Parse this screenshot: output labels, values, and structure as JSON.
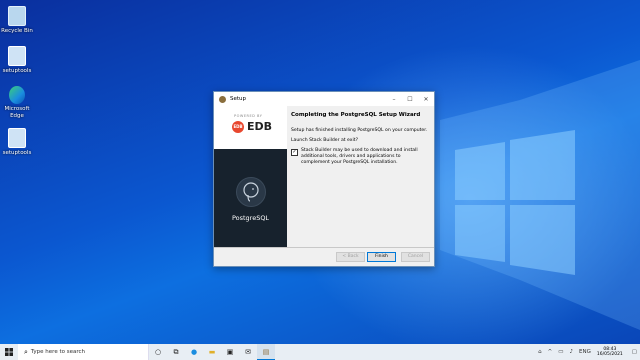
{
  "desktop": {
    "icons": [
      {
        "name": "recycle-bin",
        "label": "Recycle Bin"
      },
      {
        "name": "setuptools-1",
        "label": "setuptools"
      },
      {
        "name": "microsoft-edge",
        "label": "Microsoft Edge"
      },
      {
        "name": "setuptools-2",
        "label": "setuptools"
      }
    ]
  },
  "window": {
    "title": "Setup",
    "brand": {
      "powered": "POWERED BY",
      "badge": "EDB",
      "edb": "EDB"
    },
    "product": "PostgreSQL",
    "heading": "Completing the PostgreSQL Setup Wizard",
    "finished_text": "Setup has finished installing PostgreSQL on your computer.",
    "launch_question": "Launch Stack Builder at exit?",
    "checkbox_label": "Stack Builder may be used to download and install additional tools, drivers and applications to complement your PostgreSQL installation.",
    "checkbox_checked": true,
    "buttons": {
      "back": "< Back",
      "finish": "Finish",
      "cancel": "Cancel"
    }
  },
  "taskbar": {
    "search_placeholder": "Type here to search",
    "tray_lang": "ENG",
    "clock_time": "08:43",
    "clock_date": "16/05/2021"
  },
  "colors": {
    "accent": "#0078d7",
    "desktop": "#0b57d0",
    "edb_red": "#e8472e",
    "pg_panel": "#17222d"
  }
}
